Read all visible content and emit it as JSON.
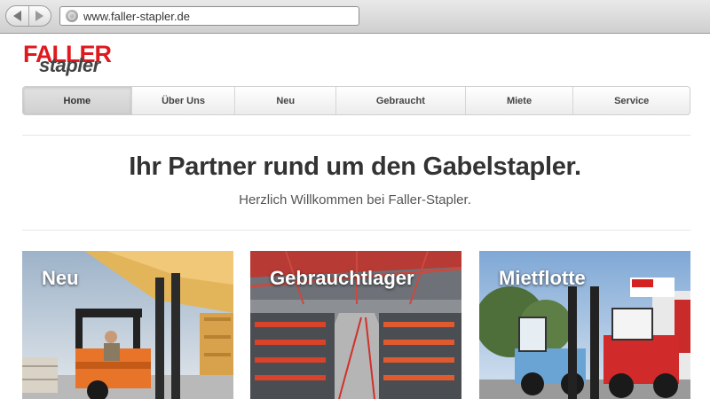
{
  "browser": {
    "url": "www.faller-stapler.de"
  },
  "logo": {
    "line1": "FALLER",
    "line2": "stapler"
  },
  "nav": {
    "items": [
      {
        "label": "Home",
        "active": true
      },
      {
        "label": "Über Uns"
      },
      {
        "label": "Neu"
      },
      {
        "label": "Gebraucht"
      },
      {
        "label": "Miete"
      },
      {
        "label": "Service"
      }
    ]
  },
  "hero": {
    "headline": "Ihr Partner rund um den Gabelstapler.",
    "subline": "Herzlich Willkommen bei Faller-Stapler."
  },
  "tiles": [
    {
      "label": "Neu"
    },
    {
      "label": "Gebrauchtlager"
    },
    {
      "label": "Mietflotte"
    }
  ],
  "colors": {
    "brand_red": "#e0191e",
    "text_dark": "#333333"
  }
}
